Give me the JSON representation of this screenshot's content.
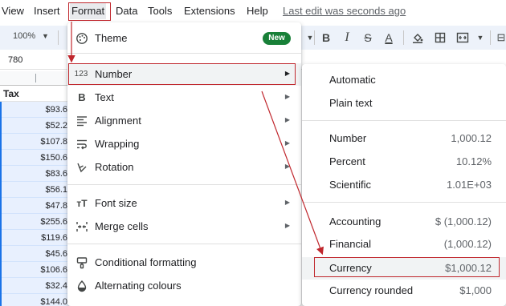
{
  "menubar": {
    "items": [
      {
        "label": "View"
      },
      {
        "label": "Insert"
      },
      {
        "label": "Format"
      },
      {
        "label": "Data"
      },
      {
        "label": "Tools"
      },
      {
        "label": "Extensions"
      },
      {
        "label": "Help"
      }
    ],
    "last_edit": "Last edit was seconds ago"
  },
  "toolbar": {
    "zoom": "100%",
    "icons": [
      "bold-icon",
      "italic-icon",
      "strikethrough-icon",
      "text-color-icon",
      "fill-color-icon",
      "borders-icon",
      "merge-cells-icon"
    ],
    "bold": "B",
    "italic": "I",
    "strike": "S",
    "textcolor": "A"
  },
  "namebox": {
    "value": "780"
  },
  "sheet": {
    "header": "Tax",
    "values": [
      "$93.6",
      "$52.2",
      "$107.8",
      "$150.6",
      "$83.6",
      "$56.1",
      "$47.8",
      "$255.6",
      "$119.6",
      "$45.6",
      "$106.6",
      "$32.4",
      "$144.0"
    ]
  },
  "format_menu": {
    "items": [
      {
        "icon": "theme-icon",
        "label": "Theme",
        "badge": "New"
      },
      {
        "icon": "number-icon",
        "icon_text": "123",
        "label": "Number",
        "submenu": true
      },
      {
        "icon": "bold-text-icon",
        "icon_text": "B",
        "label": "Text",
        "submenu": true
      },
      {
        "icon": "alignment-icon",
        "label": "Alignment",
        "submenu": true
      },
      {
        "icon": "wrapping-icon",
        "label": "Wrapping",
        "submenu": true
      },
      {
        "icon": "rotation-icon",
        "label": "Rotation",
        "submenu": true
      },
      {
        "icon": "font-size-icon",
        "icon_text": "тT",
        "label": "Font size",
        "submenu": true
      },
      {
        "icon": "merge-icon",
        "label": "Merge cells",
        "submenu": true
      },
      {
        "icon": "conditional-formatting-icon",
        "label": "Conditional formatting"
      },
      {
        "icon": "alternating-colours-icon",
        "label": "Alternating colours"
      }
    ]
  },
  "number_menu": {
    "items": [
      {
        "label": "Automatic",
        "sample": ""
      },
      {
        "label": "Plain text",
        "sample": ""
      },
      {
        "label": "Number",
        "sample": "1,000.12"
      },
      {
        "label": "Percent",
        "sample": "10.12%"
      },
      {
        "label": "Scientific",
        "sample": "1.01E+03"
      },
      {
        "label": "Accounting",
        "sample": "$ (1,000.12)"
      },
      {
        "label": "Financial",
        "sample": "(1,000.12)"
      },
      {
        "label": "Currency",
        "sample": "$1,000.12"
      },
      {
        "label": "Currency rounded",
        "sample": "$1,000"
      }
    ]
  },
  "colors": {
    "accent": "#1a73e8",
    "annotation": "#c0272d",
    "new_badge": "#188038",
    "selection": "#e8f0fe"
  }
}
